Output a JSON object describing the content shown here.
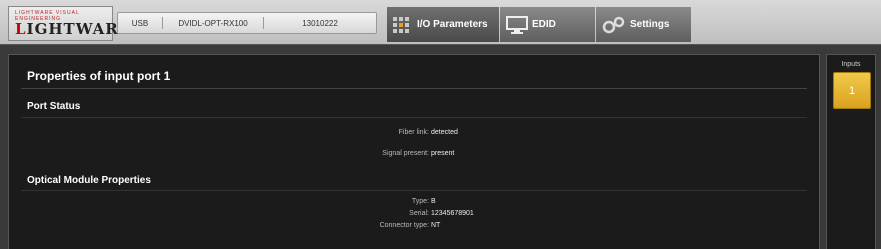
{
  "brand": {
    "tagline": "LIGHTWARE VISUAL ENGINEERING",
    "logo_light": "L",
    "logo_rest": "IGHTWARE"
  },
  "device": {
    "interface": "USB",
    "model": "DVIDL-OPT-RX100",
    "serial": "13010222"
  },
  "tabs": [
    {
      "label": "I/O Parameters",
      "icon": "io-grid-icon",
      "active": true
    },
    {
      "label": "EDID",
      "icon": "monitor-icon",
      "active": false
    },
    {
      "label": "Settings",
      "icon": "gears-icon",
      "active": false
    }
  ],
  "main": {
    "title": "Properties of input port 1",
    "port_status": {
      "heading": "Port Status",
      "props": [
        {
          "label": "Fiber link:",
          "value": "detected"
        },
        {
          "label": "Signal present:",
          "value": "present"
        }
      ]
    },
    "optical": {
      "heading": "Optical Module Properties",
      "props": [
        {
          "label": "Type:",
          "value": "B"
        },
        {
          "label": "Serial:",
          "value": "12345678901"
        },
        {
          "label": "Connector type:",
          "value": "NT"
        }
      ]
    }
  },
  "inputs": {
    "label": "Inputs",
    "items": [
      "1"
    ]
  },
  "colors": {
    "accent": "#e0ad2a",
    "panel": "#1b1b1b"
  }
}
